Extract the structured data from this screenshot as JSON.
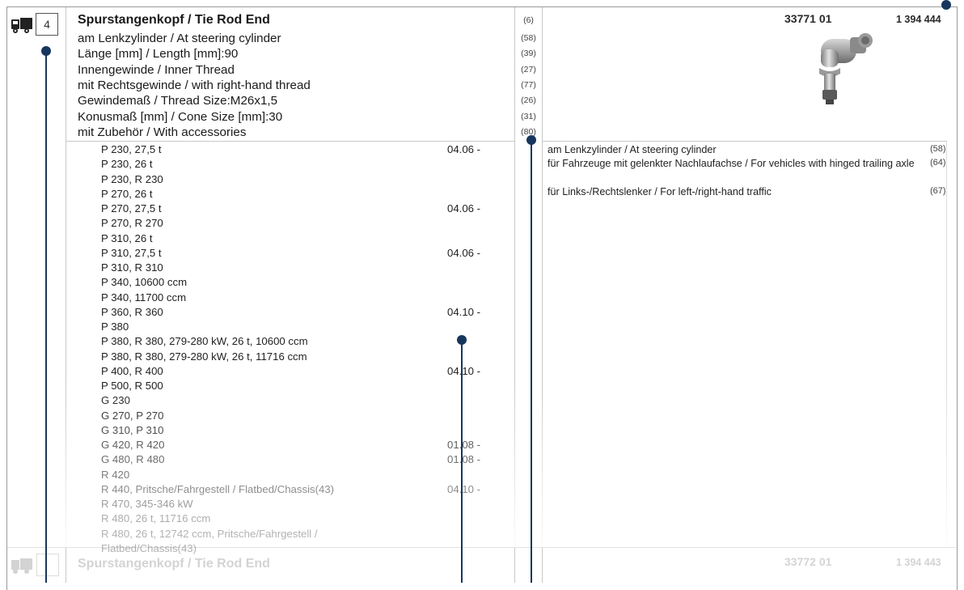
{
  "header": {
    "position_number": "4",
    "part_number": "33771 01",
    "order_number": "1 394 444"
  },
  "description": {
    "title": "Spurstangenkopf / Tie Rod End",
    "title_ref": "(6)",
    "attributes": [
      {
        "text": "am Lenkzylinder / At steering cylinder",
        "ref": "(58)"
      },
      {
        "text": "Länge [mm] / Length [mm]:90",
        "ref": "(39)"
      },
      {
        "text": "Innengewinde / Inner Thread",
        "ref": "(27)"
      },
      {
        "text": "mit Rechtsgewinde / with right-hand thread",
        "ref": "(77)"
      },
      {
        "text": "Gewindemaß / Thread Size:M26x1,5",
        "ref": "(26)"
      },
      {
        "text": "Konusmaß [mm] / Cone Size [mm]:30",
        "ref": "(31)"
      },
      {
        "text": "mit Zubehör / With accessories",
        "ref": "(80)"
      }
    ]
  },
  "vehicles": [
    {
      "name": "P 230, 27,5 t",
      "date": "04.06 -"
    },
    {
      "name": "P 230, 26 t",
      "date": ""
    },
    {
      "name": "P 230, R 230",
      "date": ""
    },
    {
      "name": "P 270, 26 t",
      "date": ""
    },
    {
      "name": "P 270, 27,5 t",
      "date": "04.06 -"
    },
    {
      "name": "P 270, R 270",
      "date": ""
    },
    {
      "name": "P 310, 26 t",
      "date": ""
    },
    {
      "name": "P 310, 27,5 t",
      "date": "04.06 -"
    },
    {
      "name": "P 310, R 310",
      "date": ""
    },
    {
      "name": "P 340, 10600 ccm",
      "date": ""
    },
    {
      "name": "P 340, 11700 ccm",
      "date": ""
    },
    {
      "name": "P 360, R 360",
      "date": "04.10 -"
    },
    {
      "name": "P 380",
      "date": ""
    },
    {
      "name": "P 380, R 380, 279-280 kW, 26 t, 10600 ccm",
      "date": ""
    },
    {
      "name": "P 380, R 380, 279-280 kW, 26 t, 11716 ccm",
      "date": ""
    },
    {
      "name": "P 400, R 400",
      "date": "04.10 -"
    },
    {
      "name": "P 500, R 500",
      "date": ""
    },
    {
      "name": "G 230",
      "date": ""
    },
    {
      "name": "G 270, P 270",
      "date": ""
    },
    {
      "name": "G 310, P 310",
      "date": ""
    },
    {
      "name": "G 420, R 420",
      "date": "01.08 -"
    },
    {
      "name": "G 480, R 480",
      "date": "01.08 -"
    },
    {
      "name": "R 420",
      "date": ""
    },
    {
      "name": "R 440, Pritsche/Fahrgestell / Flatbed/Chassis(43)",
      "date": "04.10 -"
    },
    {
      "name": "R 470, 345-346 kW",
      "date": ""
    },
    {
      "name": "R 480, 26 t, 11716 ccm",
      "date": ""
    },
    {
      "name": "R 480, 26 t, 12742 ccm, Pritsche/Fahrgestell /",
      "date": ""
    },
    {
      "name": "Flatbed/Chassis(43)",
      "date": ""
    }
  ],
  "notes": [
    {
      "text": "am Lenkzylinder / At steering cylinder",
      "ref": "(58)"
    },
    {
      "text": "für Fahrzeuge mit gelenkter Nachlaufachse / For vehicles with hinged trailing axle",
      "ref": "(64)"
    },
    {
      "text": "für Links-/Rechtslenker / For left-/right-hand traffic",
      "ref": "(67)"
    }
  ],
  "next_item": {
    "title": "Spurstangenkopf / Tie Rod End",
    "part_number": "33772 01",
    "order_number": "1 394 443"
  },
  "colors": {
    "callout": "#17365d",
    "border": "#9a9a9a"
  },
  "icons": {
    "vehicle": "truck-icon",
    "product": "tie-rod-end-image"
  }
}
